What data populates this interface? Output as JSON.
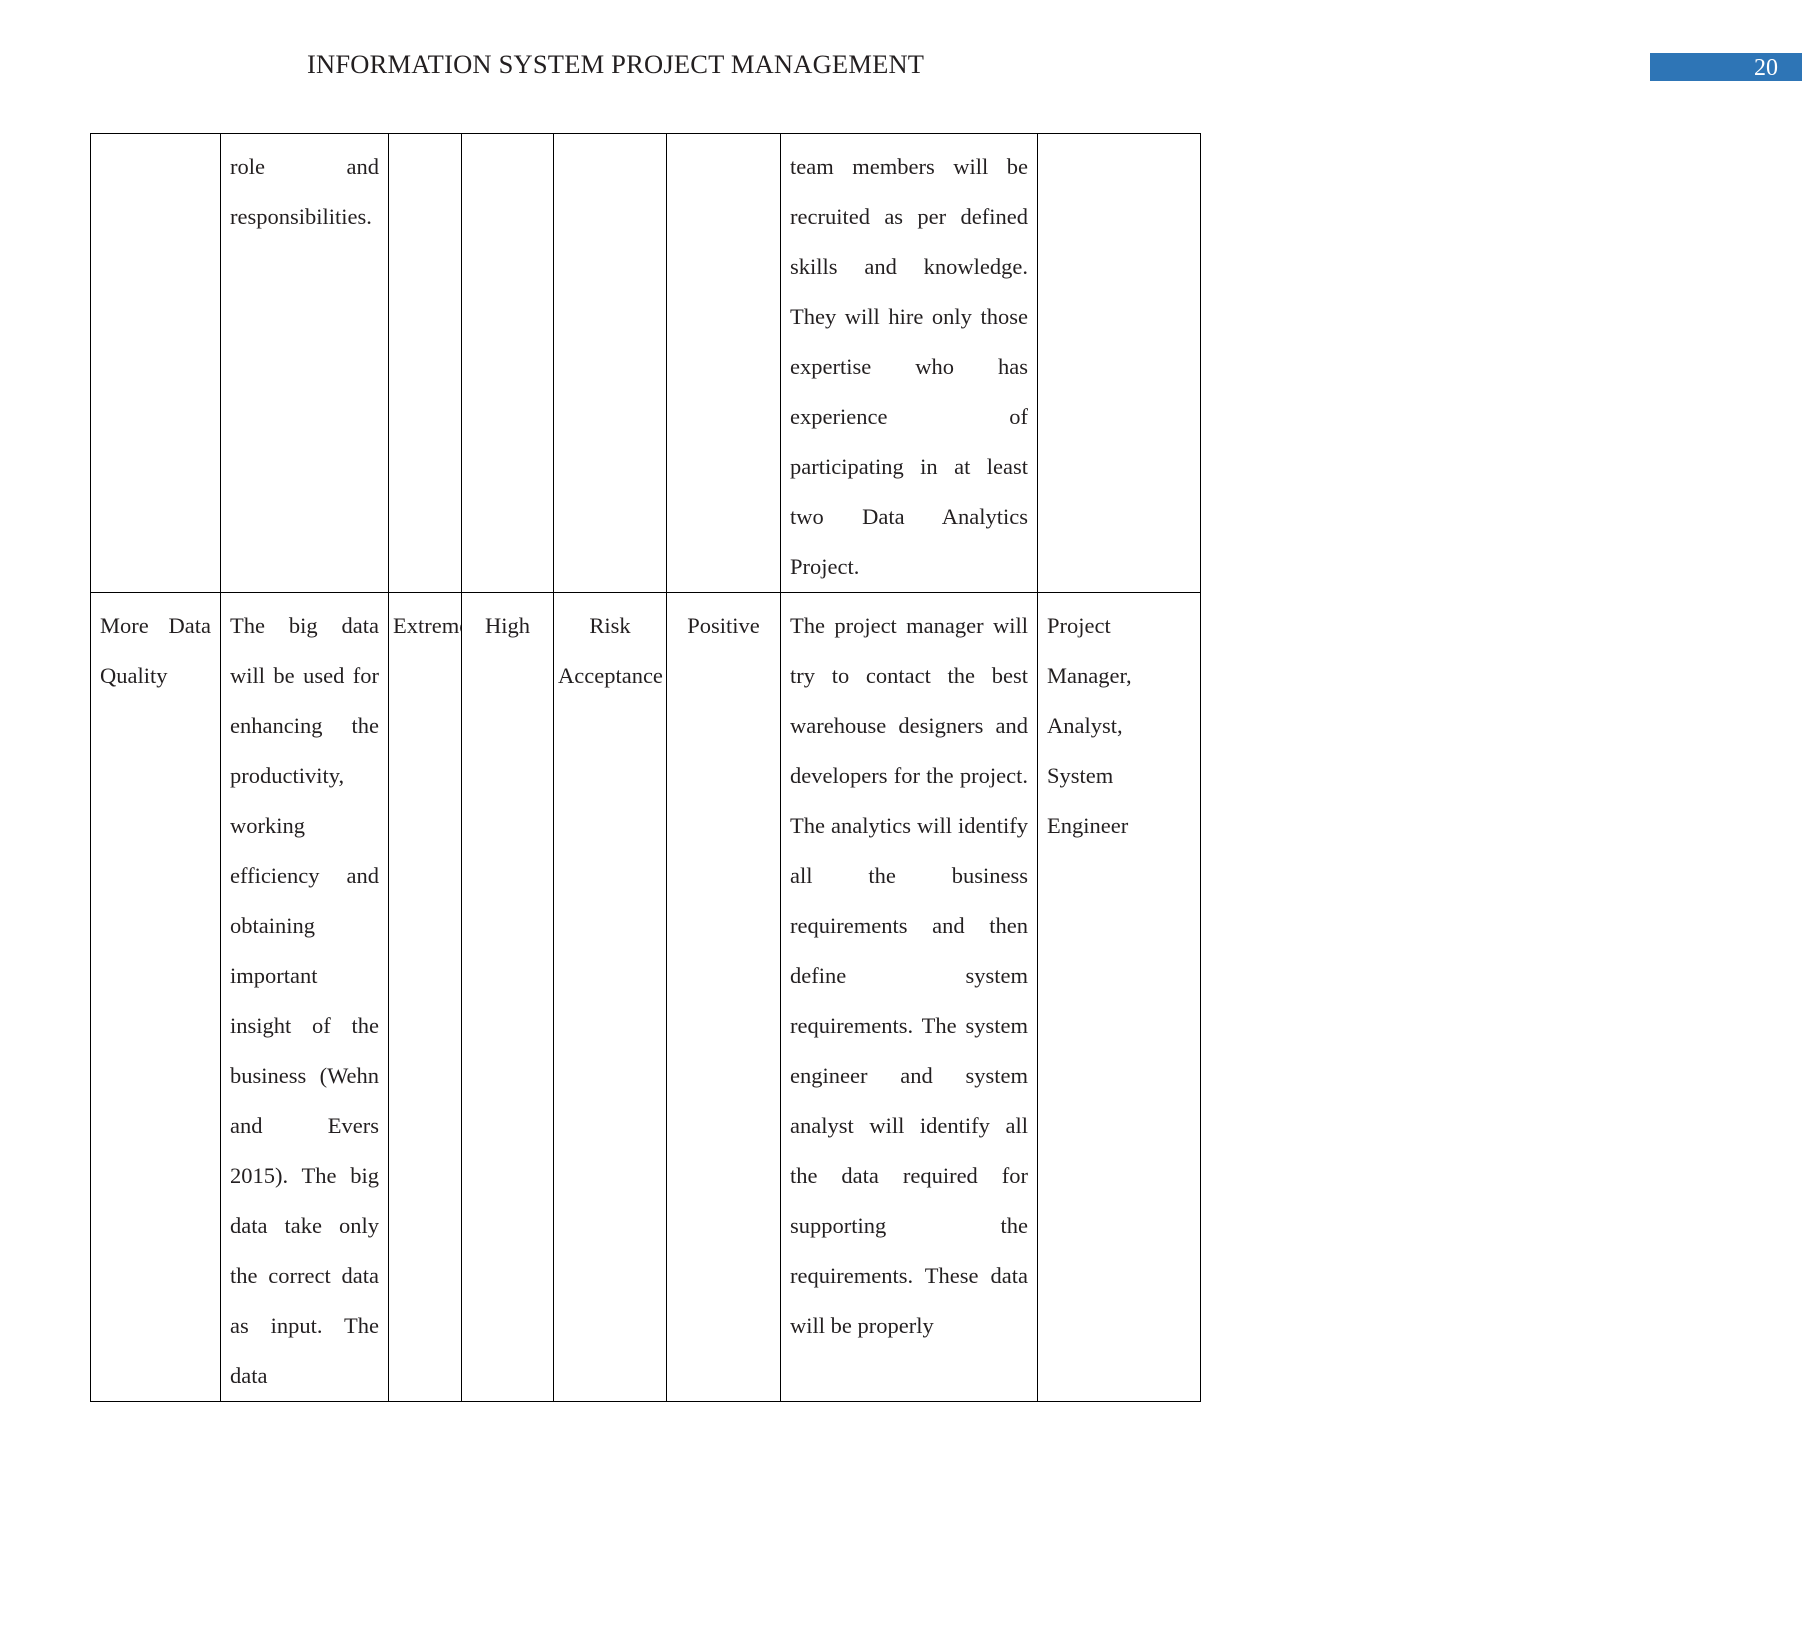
{
  "header": {
    "title": "INFORMATION SYSTEM PROJECT MANAGEMENT",
    "page_number": "20",
    "page_number_bar_color": "#2e75b6",
    "page_number_text_color": "#ffffff"
  },
  "table": {
    "column_count": 8,
    "rows": [
      {
        "name": "continuation-row",
        "cells": {
          "c1": "",
          "c2": "role and responsibilities.",
          "c3": "",
          "c4": "",
          "c5": "",
          "c6": "",
          "c7": "team members will be recruited as per defined skills and knowledge. They will hire only those expertise who has experience of participating in at least two Data Analytics Project.",
          "c8": ""
        }
      },
      {
        "name": "more-data-quality-row",
        "cells": {
          "c1": "More Data Quality",
          "c2": "The big data will be used for enhancing the productivity, working efficiency and obtaining important insight of the business (Wehn and Evers 2015). The big data take only the correct data as input. The data",
          "c3": "Extreme",
          "c4": "High",
          "c5": "Risk Acceptance",
          "c6": "Positive",
          "c7": "The project manager will try to contact the best warehouse designers and developers for the project. The analytics will identify all the business requirements and then define system requirements. The system engineer and system analyst will identify all the data required for supporting the requirements. These data will be properly",
          "c8": "Project Manager, Analyst, System Engineer"
        }
      }
    ]
  }
}
